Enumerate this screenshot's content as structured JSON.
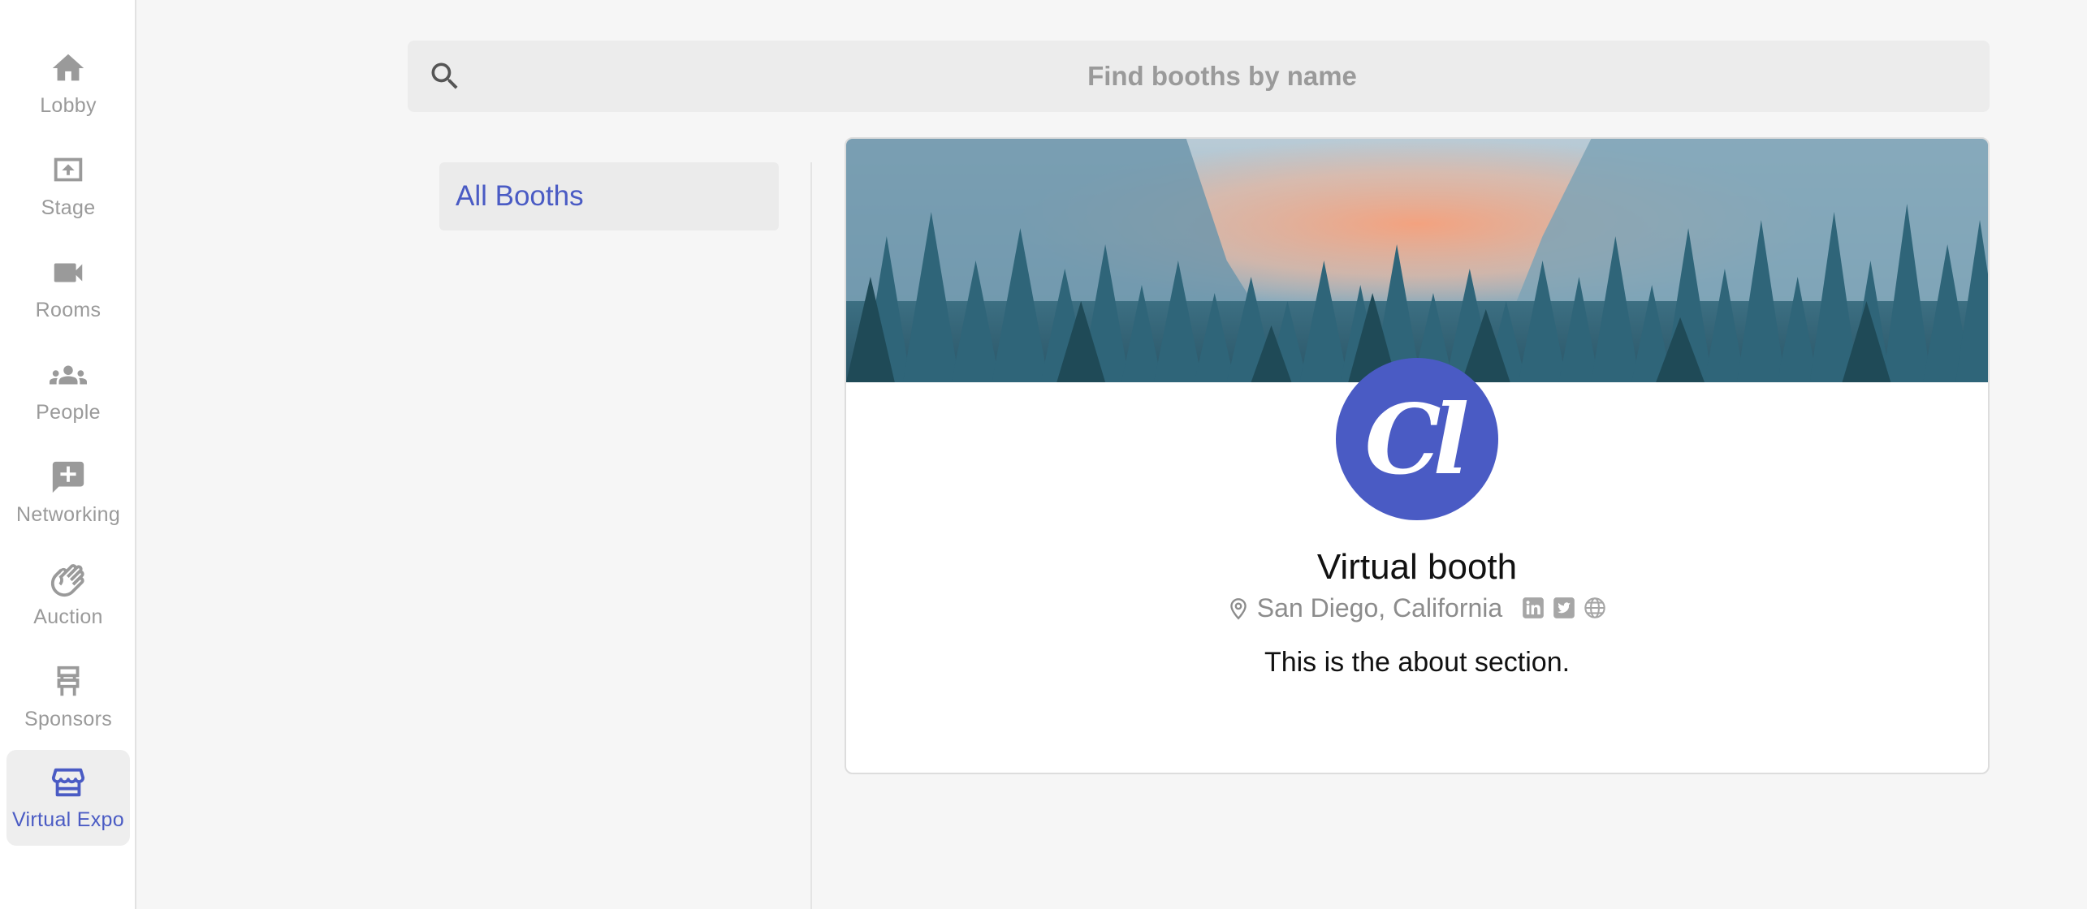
{
  "nav": {
    "items": [
      {
        "label": "Lobby",
        "icon": "home-icon"
      },
      {
        "label": "Stage",
        "icon": "stage-icon"
      },
      {
        "label": "Rooms",
        "icon": "video-camera-icon"
      },
      {
        "label": "People",
        "icon": "people-icon"
      },
      {
        "label": "Networking",
        "icon": "chat-plus-icon"
      },
      {
        "label": "Auction",
        "icon": "hands-icon"
      },
      {
        "label": "Sponsors",
        "icon": "sponsor-icon"
      },
      {
        "label": "Virtual Expo",
        "icon": "storefront-icon",
        "active": true
      }
    ]
  },
  "search": {
    "placeholder": "Find booths by name",
    "value": ""
  },
  "categories": {
    "items": [
      {
        "label": "All Booths",
        "active": true
      }
    ]
  },
  "booth": {
    "logo_text": "Cl",
    "name": "Virtual booth",
    "location": "San Diego, California",
    "about": "This is the about section.",
    "social_icons": [
      "linkedin-icon",
      "twitter-icon",
      "globe-icon"
    ]
  },
  "colors": {
    "accent": "#4a5bc4",
    "muted": "#9a9a9a",
    "background": "#f6f6f6"
  }
}
